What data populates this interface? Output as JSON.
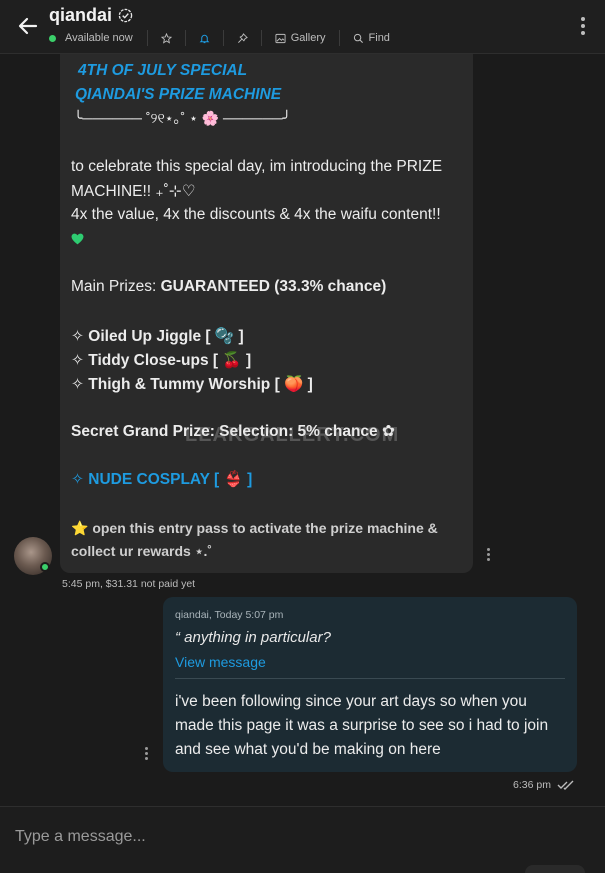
{
  "header": {
    "title": "qiandai",
    "status": "Available now",
    "actions": [
      {
        "label": "",
        "icon": "star-icon"
      },
      {
        "label": "",
        "icon": "bell-icon"
      },
      {
        "label": "",
        "icon": "pin-icon"
      },
      {
        "label": "Gallery",
        "icon": "image-icon"
      },
      {
        "label": "Find",
        "icon": "search-icon"
      }
    ]
  },
  "incoming": {
    "lines": [
      "4TH OF JULY SPECIAL",
      "QIANDAI'S PRIZE MACHINE",
      "╰────── ˚୨୧⋆｡˚ ⋆ 🌸 ──────╯",
      "to celebrate this special day, im introducing the PRIZE",
      "MACHINE!! ₊˚⊹♡",
      "4x the value, 4x the discounts & 4x the waifu content!!",
      "Main Prizes: ",
      "GUARANTEED (33.3% chance)",
      "✧ Oiled Up Jiggle [ 🫧 ]",
      "✧ Tiddy Close-ups [ 🍒 ]",
      "✧ Thigh & Tummy Worship [ 🍑 ]",
      "Secret Grand Prize: Selection: 5% chance ✿",
      "✧ NUDE COSPLAY [ 👙 ]",
      "⭐ open this entry pass to activate the prize machine &",
      "collect ur rewards ⋆.˚"
    ],
    "time": "5:45 pm,",
    "price": "$31.31 not paid yet",
    "watermark": "LEAKGALLERY.COM"
  },
  "outgoing": {
    "quote_meta": "qiandai, Today 5:07 pm",
    "quote_text": "“ anything in particular?",
    "view_message": "View message",
    "lines": [
      "i've been following since your art days so when you",
      "made this page it was a surprise to see so i had to join",
      "and see what you'd be making on here"
    ],
    "time": "6:36 pm"
  },
  "composer": {
    "placeholder": "Type a message..."
  },
  "colors": {
    "accent": "#1e9be0",
    "online": "#3bcf6a",
    "heart": "#2ecc71"
  }
}
